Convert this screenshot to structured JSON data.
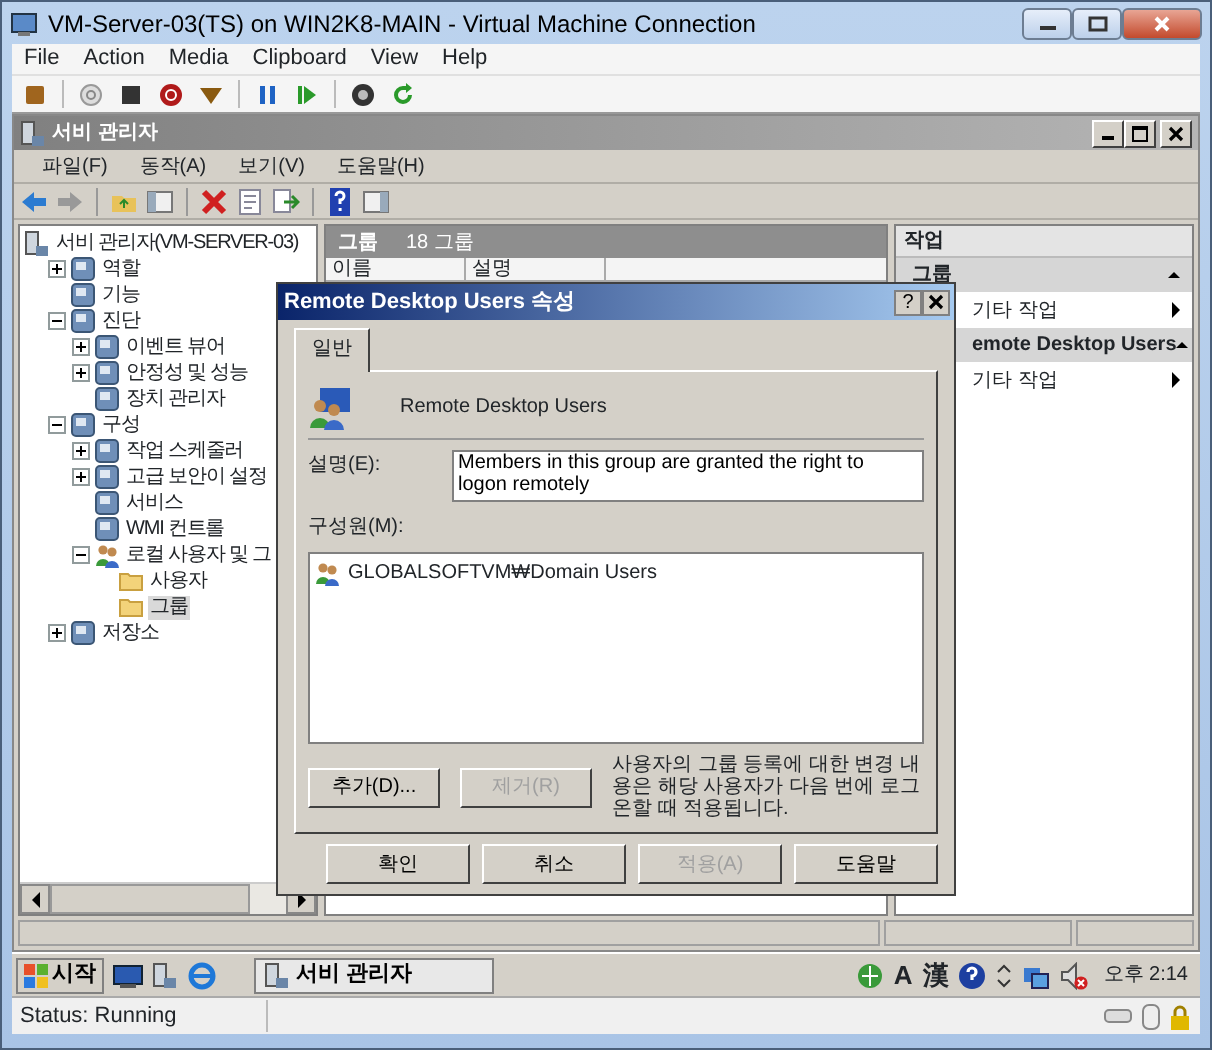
{
  "window": {
    "title": "VM-Server-03(TS) on WIN2K8-MAIN - Virtual Machine Connection"
  },
  "menu": [
    "File",
    "Action",
    "Media",
    "Clipboard",
    "View",
    "Help"
  ],
  "server_manager": {
    "title": "서비 관리자",
    "menu": [
      "파일(F)",
      "동작(A)",
      "보기(V)",
      "도움말(H)"
    ],
    "tree": [
      {
        "label": "서비 관리자(VM-SERVER-03)",
        "kind": "server",
        "selected": false,
        "children": [
          {
            "label": "역할",
            "kind": "app",
            "expanded": false,
            "selected": false
          },
          {
            "label": "기능",
            "kind": "app",
            "selected": false
          },
          {
            "label": "진단",
            "kind": "app",
            "expanded": true,
            "selected": false,
            "children": [
              {
                "label": "이벤트 뷰어",
                "kind": "app",
                "expanded": false,
                "selected": false
              },
              {
                "label": "안정성 및 성능",
                "kind": "app",
                "expanded": false,
                "selected": false
              },
              {
                "label": "장치 관리자",
                "kind": "app",
                "selected": false
              }
            ]
          },
          {
            "label": "구성",
            "kind": "app",
            "expanded": true,
            "selected": false,
            "children": [
              {
                "label": "작업 스케줄러",
                "kind": "app",
                "expanded": false,
                "selected": false
              },
              {
                "label": "고급 보안이 설정",
                "kind": "app",
                "expanded": false,
                "selected": false
              },
              {
                "label": "서비스",
                "kind": "app",
                "selected": false
              },
              {
                "label": "WMI 컨트롤",
                "kind": "app",
                "selected": false
              },
              {
                "label": "로컬 사용자 및 그",
                "kind": "users",
                "expanded": true,
                "selected": false,
                "children": [
                  {
                    "label": "사용자",
                    "kind": "folder",
                    "selected": false
                  },
                  {
                    "label": "그룹",
                    "kind": "folder",
                    "selected": true
                  }
                ]
              }
            ]
          },
          {
            "label": "저장소",
            "kind": "app",
            "expanded": false,
            "selected": false
          }
        ]
      }
    ],
    "content": {
      "title": "그룹",
      "count": "18 그룹",
      "columns": [
        "이름",
        "설명"
      ]
    },
    "actions": {
      "title": "작업",
      "sections": [
        {
          "title": "그룹",
          "items": [
            "기타 작업"
          ]
        },
        {
          "title": "emote Desktop Users",
          "items": [
            "기타 작업"
          ]
        }
      ]
    }
  },
  "dialog": {
    "title": "Remote Desktop Users 속성",
    "title_buttons": [
      "?"
    ],
    "tabs": [
      {
        "label": "일반",
        "selected": true
      }
    ],
    "group_name": "Remote Desktop Users",
    "description_label": "설명(E):",
    "description": "Members in this group are granted the right to logon remotely",
    "members_label": "구성원(M):",
    "members": [
      "GLOBALSOFTVM₩Domain Users"
    ],
    "member_buttons": [
      {
        "label": "추가(D)...",
        "disabled": false
      },
      {
        "label": "제거(R)",
        "disabled": true
      }
    ],
    "note": "사용자의 그룹 등록에 대한 변경 내용은 해당 사용자가 다음 번에 로그온할 때 적용됩니다.",
    "buttons": [
      {
        "label": "확인",
        "disabled": false
      },
      {
        "label": "취소",
        "disabled": false
      },
      {
        "label": "적용(A)",
        "disabled": true
      },
      {
        "label": "도움말",
        "disabled": false
      }
    ]
  },
  "taskbar": {
    "start": "시작",
    "task": "서비 관리자",
    "ime": [
      "A",
      "漢"
    ],
    "clock": "오후 2:14"
  },
  "status_bar": "Status: Running"
}
